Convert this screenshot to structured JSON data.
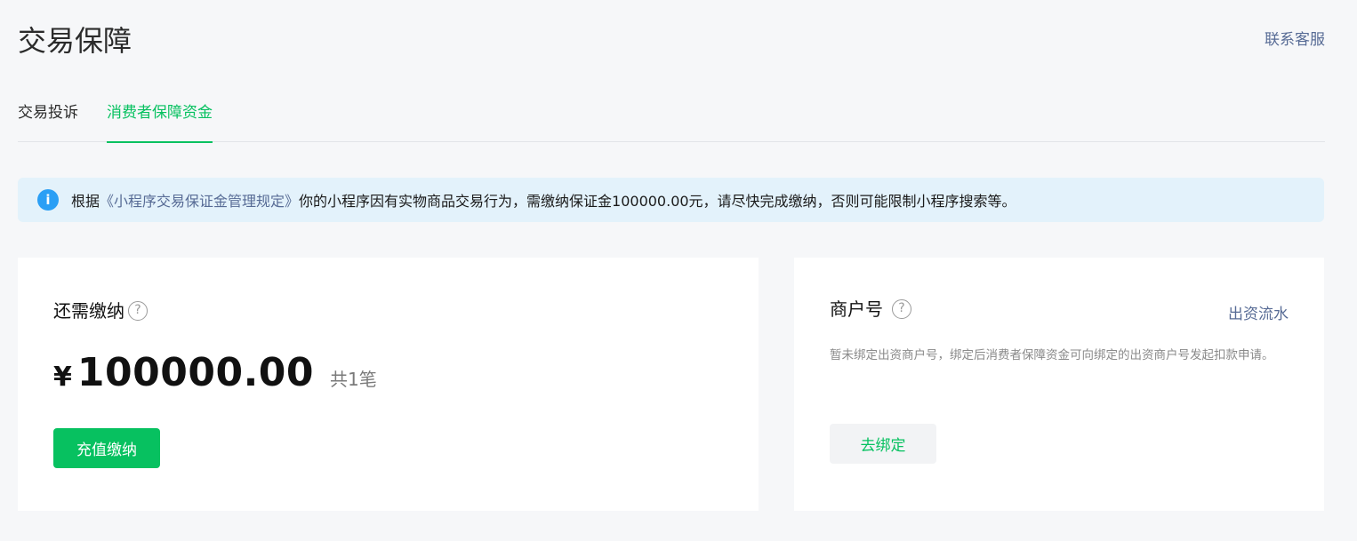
{
  "header": {
    "title": "交易保障",
    "contact_label": "联系客服"
  },
  "tabs": [
    {
      "label": "交易投诉",
      "active": false
    },
    {
      "label": "消费者保障资金",
      "active": true
    }
  ],
  "notice": {
    "prefix": "根据",
    "link_text": "《小程序交易保证金管理规定》",
    "suffix": "你的小程序因有实物商品交易行为，需缴纳保证金100000.00元，请尽快完成缴纳，否则可能限制小程序搜索等。",
    "icon": "info-icon"
  },
  "due_card": {
    "label": "还需缴纳",
    "currency": "¥",
    "amount": "100000.00",
    "count_text": "共1笔",
    "pay_button": "充值缴纳"
  },
  "merchant_card": {
    "label": "商户号",
    "flow_link": "出资流水",
    "description": "暂未绑定出资商户号，绑定后消费者保障资金可向绑定的出资商户号发起扣款申请。",
    "bind_button": "去绑定"
  },
  "colors": {
    "accent": "#07c160",
    "link": "#576b95",
    "info": "#2a9ff5",
    "notice_bg": "#e3f2fb"
  }
}
